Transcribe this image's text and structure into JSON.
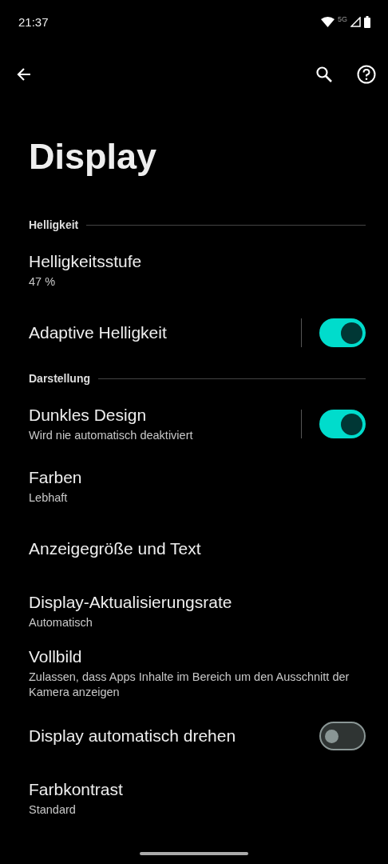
{
  "status_bar": {
    "time": "21:37",
    "network": "5G"
  },
  "title": "Display",
  "sections": [
    {
      "header": "Helligkeit",
      "items": [
        {
          "kind": "plain",
          "title": "Helligkeitsstufe",
          "summary": "47 %"
        },
        {
          "kind": "primary-switch",
          "title": "Adaptive Helligkeit",
          "on": true
        }
      ]
    },
    {
      "header": "Darstellung",
      "items": [
        {
          "kind": "primary-switch",
          "title": "Dunkles Design",
          "summary": "Wird nie automatisch deaktiviert",
          "on": true
        },
        {
          "kind": "plain",
          "title": "Farben",
          "summary": "Lebhaft"
        },
        {
          "kind": "plain",
          "title": "Anzeigegröße und Text"
        },
        {
          "kind": "plain",
          "title": "Display-Aktualisierungsrate",
          "summary": "Automatisch"
        },
        {
          "kind": "plain",
          "title": "Vollbild",
          "summary": "Zulassen, dass Apps Inhalte im Bereich um den Ausschnitt der Kamera anzeigen"
        },
        {
          "kind": "switch",
          "title": "Display automatisch drehen",
          "on": false
        },
        {
          "kind": "plain",
          "title": "Farbkontrast",
          "summary": "Standard"
        }
      ]
    }
  ]
}
